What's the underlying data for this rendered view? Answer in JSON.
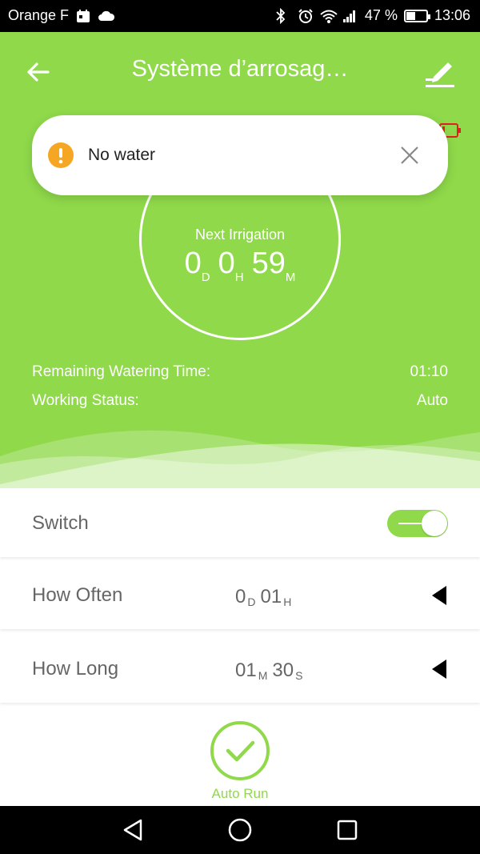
{
  "status_bar": {
    "carrier": "Orange F",
    "battery_percent": "47 %",
    "battery_level": 0.47,
    "time": "13:06"
  },
  "header": {
    "title": "Système d’arrosag…",
    "back_icon": "arrow-left-icon",
    "edit_icon": "pencil-icon"
  },
  "toast": {
    "message": "No water",
    "icon": "warning-icon",
    "accent_color": "#f5a623"
  },
  "next_irrigation": {
    "label": "Next Irrigation",
    "days": "0",
    "days_unit": "D",
    "hours": "0",
    "hours_unit": "H",
    "minutes": "59",
    "minutes_unit": "M"
  },
  "info": {
    "remaining_label": "Remaining Watering Time:",
    "remaining_value": "01:10",
    "status_label": "Working Status:",
    "status_value": "Auto"
  },
  "settings": {
    "switch_label": "Switch",
    "switch_on": true,
    "how_often_label": "How Often",
    "how_often_days": "0",
    "how_often_days_unit": "D",
    "how_often_hours": "01",
    "how_often_hours_unit": "H",
    "how_long_label": "How Long",
    "how_long_minutes": "01",
    "how_long_minutes_unit": "M",
    "how_long_seconds": "30",
    "how_long_seconds_unit": "S"
  },
  "auto_run": {
    "label": "Auto Run"
  },
  "colors": {
    "brand_green": "#8fd94a",
    "warning_orange": "#f5a623",
    "battery_low_red": "#e02020"
  }
}
